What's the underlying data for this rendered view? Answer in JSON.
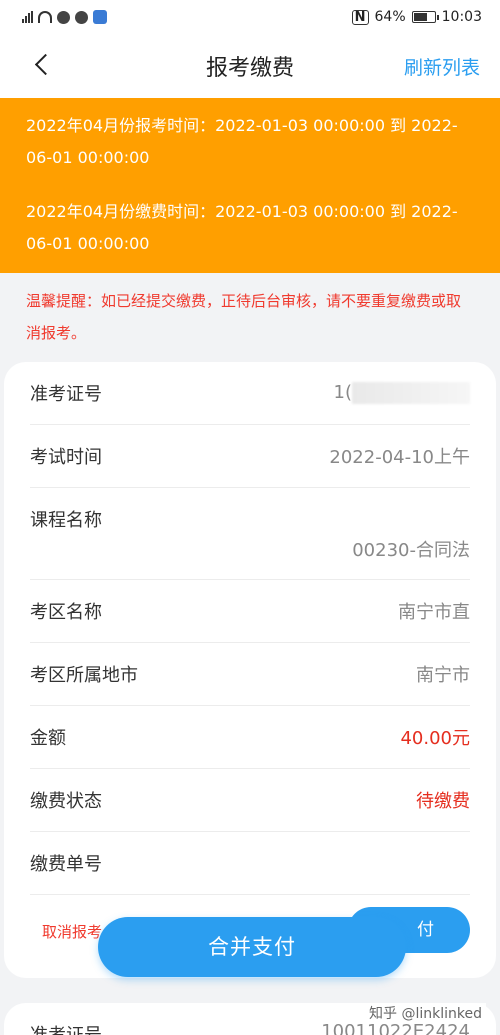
{
  "status_bar": {
    "battery": "64%",
    "time": "10:03"
  },
  "nav": {
    "title": "报考缴费",
    "refresh": "刷新列表"
  },
  "banner": {
    "exam_time": "2022年04月份报考时间：2022-01-03 00:00:00 到 2022-06-01 00:00:00",
    "pay_time": "2022年04月份缴费时间：2022-01-03 00:00:00 到 2022-06-01 00:00:00"
  },
  "reminder": "温馨提醒：如已经提交缴费，正待后台审核，请不要重复缴费或取消报考。",
  "record": {
    "rows": [
      {
        "label": "准考证号",
        "value": "1("
      },
      {
        "label": "考试时间",
        "value": "2022-04-10上午"
      },
      {
        "label": "课程名称",
        "value": "00230-合同法"
      },
      {
        "label": "考区名称",
        "value": "南宁市直"
      },
      {
        "label": "考区所属地市",
        "value": "南宁市"
      },
      {
        "label": "金额",
        "value": "40.00元"
      },
      {
        "label": "缴费状态",
        "value": "待缴费"
      },
      {
        "label": "缴费单号",
        "value": ""
      }
    ],
    "cancel": "取消报考",
    "pay": "付"
  },
  "merge_pay": "合并支付",
  "next_record": {
    "label": "准考证号",
    "value": "10011022E2424"
  },
  "watermark": "知乎 @linklinked"
}
